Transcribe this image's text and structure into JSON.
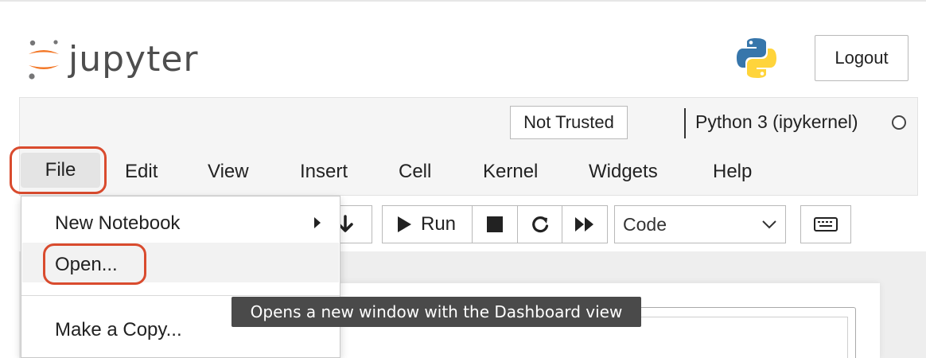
{
  "header": {
    "logo_text": "jupyter",
    "logout_label": "Logout",
    "python_logo_icon": "python-logo"
  },
  "notebook_bar": {
    "trust_label": "Not Trusted",
    "kernel_name": "Python 3 (ipykernel)",
    "kernel_status_icon": "idle-circle"
  },
  "menubar": {
    "items": [
      {
        "label": "File"
      },
      {
        "label": "Edit"
      },
      {
        "label": "View"
      },
      {
        "label": "Insert"
      },
      {
        "label": "Cell"
      },
      {
        "label": "Kernel"
      },
      {
        "label": "Widgets"
      },
      {
        "label": "Help"
      }
    ]
  },
  "file_menu": {
    "items": [
      {
        "label": "New Notebook",
        "has_submenu": true
      },
      {
        "label": "Open..."
      },
      {
        "label": "Make a Copy..."
      }
    ]
  },
  "toolbar": {
    "run_label": "Run",
    "cell_type_selected": "Code"
  },
  "tooltip": {
    "text": "Opens a new window with the Dashboard view"
  },
  "colors": {
    "highlight": "#d94b2e",
    "jupyter_orange": "#f37726",
    "python_blue": "#3776ab",
    "python_yellow": "#ffd43b"
  }
}
